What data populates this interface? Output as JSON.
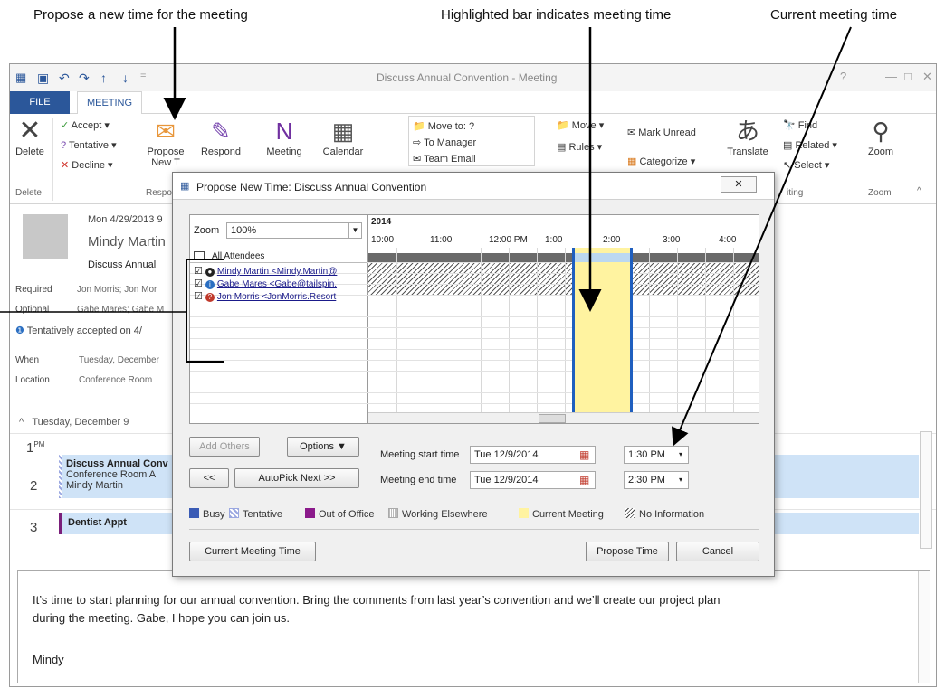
{
  "callouts": {
    "propose": "Propose a new time for the meeting",
    "highlighted": "Highlighted bar indicates meeting time",
    "current": "Current meeting time"
  },
  "window": {
    "title": "Discuss Annual Convention - Meeting",
    "help": "?",
    "restore": "⧉",
    "minimize": "—",
    "maximize": "□",
    "close": "✕"
  },
  "qat": {
    "save": "💾",
    "undo": "↶",
    "redo": "↷",
    "up": "↑",
    "down": "↓",
    "more": "="
  },
  "tabs": {
    "file": "FILE",
    "meeting": "MEETING"
  },
  "ribbon": {
    "delete": "Delete",
    "accept": "Accept",
    "tentative": "Tentative",
    "decline": "Decline",
    "propose": "Propose",
    "propose2": "New T",
    "respond": "Respond",
    "meeting": "Meeting",
    "calendar": "Calendar",
    "move_to": "Move to: ?",
    "to_manager": "To Manager",
    "team_email": "Team Email",
    "move": "Move",
    "rules": "Rules",
    "mark_unread": "Mark Unread",
    "categorize": "Categorize",
    "translate": "Translate",
    "find": "Find",
    "related": "Related",
    "select": "Select",
    "zoom": "Zoom",
    "g_delete": "Delete",
    "g_respond": "Respo",
    "g_editing": "iting",
    "g_zoom": "Zoom"
  },
  "reading": {
    "date": "Mon 4/29/2013 9",
    "sender": "Mindy Martin",
    "subject": "Discuss Annual",
    "required_label": "Required",
    "required": "Jon Morris; Jon Mor",
    "optional_label": "Optional",
    "optional": "Gabe Mares; Gabe M",
    "info": "Tentatively accepted on 4/",
    "when_label": "When",
    "when": "Tuesday, December",
    "location_label": "Location",
    "location": "Conference Room"
  },
  "calendar": {
    "day": "Tuesday, December 9",
    "h1": "1",
    "pm": "PM",
    "h2": "2",
    "h3": "3",
    "event_title": "Discuss Annual Conv",
    "event_room": "Conference Room A",
    "event_org": "Mindy Martin",
    "dentist": "Dentist Appt"
  },
  "message": {
    "line1": "It’s time to start planning for our annual convention. Bring the comments from last year’s convention and we’ll create our project plan",
    "line2": "during the meeting. Gabe, I hope you can join us.",
    "signature": "Mindy"
  },
  "dialog": {
    "title": "Propose New Time: Discuss Annual Convention",
    "close": "✕",
    "zoom_label": "Zoom",
    "zoom_value": "100%",
    "year": "2014",
    "times": [
      "10:00",
      "11:00",
      "12:00 PM",
      "1:00",
      "2:00",
      "3:00",
      "4:00"
    ],
    "all_attendees": "All Attendees",
    "attendees": [
      "Mindy Martin <Mindy.Martin@",
      "Gabe Mares <Gabe@tailspin.",
      "Jon Morris <JonMorris.Resort"
    ],
    "add_others": "Add Others",
    "options": "Options",
    "prev": "<<",
    "autopick": "AutoPick Next >>",
    "start_label": "Meeting start time",
    "start_date": "Tue 12/9/2014",
    "start_time": "1:30 PM",
    "end_label": "Meeting end time",
    "end_date": "Tue 12/9/2014",
    "end_time": "2:30 PM",
    "legend": {
      "busy": "Busy",
      "tentative": "Tentative",
      "oof": "Out of Office",
      "elsewhere": "Working Elsewhere",
      "current": "Current Meeting",
      "noinfo": "No Information"
    },
    "current_btn": "Current Meeting Time",
    "propose_btn": "Propose Time",
    "cancel_btn": "Cancel"
  },
  "colors": {
    "accent": "#2b579a",
    "busy": "#3a5bb5",
    "tentative": "#9aa7e0",
    "oof": "#8b1a8b",
    "current": "#fff3a0",
    "meeting_border": "#1f5fbf"
  }
}
